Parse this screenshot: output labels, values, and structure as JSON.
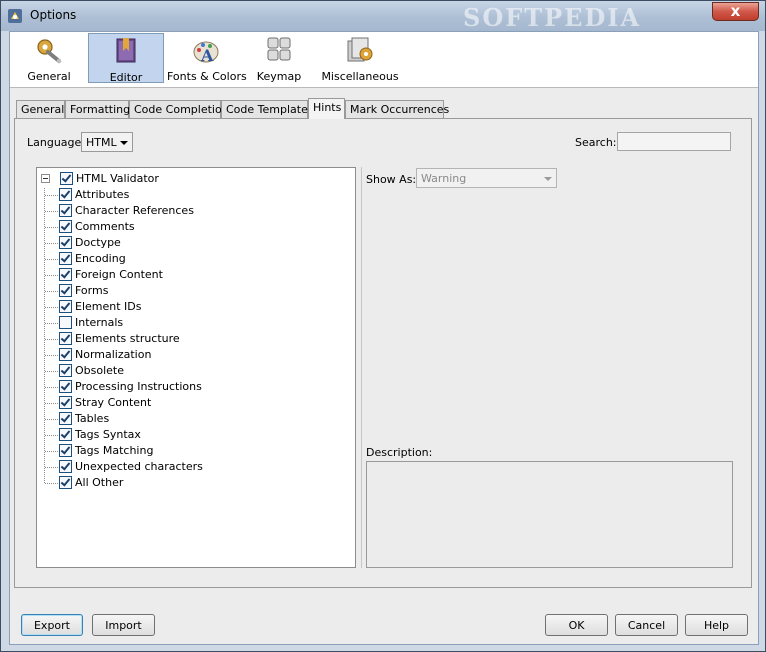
{
  "window": {
    "title": "Options",
    "watermark": "SOFTPEDIA",
    "close_symbol": "x"
  },
  "categories": [
    {
      "label": "General",
      "icon": "gear-wrench-icon"
    },
    {
      "label": "Editor",
      "icon": "editor-book-icon",
      "selected": true
    },
    {
      "label": "Fonts & Colors",
      "icon": "font-palette-icon"
    },
    {
      "label": "Keymap",
      "icon": "keyboard-icon"
    },
    {
      "label": "Miscellaneous",
      "icon": "misc-gear-icon"
    }
  ],
  "tabs": [
    {
      "label": "General"
    },
    {
      "label": "Formatting"
    },
    {
      "label": "Code Completion"
    },
    {
      "label": "Code Templates"
    },
    {
      "label": "Hints",
      "selected": true
    },
    {
      "label": "Mark Occurrences"
    }
  ],
  "hints": {
    "language_label": "Language:",
    "language_value": "HTML",
    "search_label": "Search:",
    "search_value": "",
    "tree": {
      "root": {
        "label": "HTML Validator",
        "checked": true
      },
      "items": [
        {
          "label": "Attributes",
          "checked": true
        },
        {
          "label": "Character References",
          "checked": true
        },
        {
          "label": "Comments",
          "checked": true
        },
        {
          "label": "Doctype",
          "checked": true
        },
        {
          "label": "Encoding",
          "checked": true
        },
        {
          "label": "Foreign Content",
          "checked": true
        },
        {
          "label": "Forms",
          "checked": true
        },
        {
          "label": "Element IDs",
          "checked": true
        },
        {
          "label": "Internals",
          "checked": false
        },
        {
          "label": "Elements structure",
          "checked": true
        },
        {
          "label": "Normalization",
          "checked": true
        },
        {
          "label": "Obsolete",
          "checked": true
        },
        {
          "label": "Processing Instructions",
          "checked": true
        },
        {
          "label": "Stray Content",
          "checked": true
        },
        {
          "label": "Tables",
          "checked": true
        },
        {
          "label": "Tags Syntax",
          "checked": true
        },
        {
          "label": "Tags Matching",
          "checked": true
        },
        {
          "label": "Unexpected characters",
          "checked": true
        },
        {
          "label": "All Other",
          "checked": true
        }
      ]
    },
    "show_as_label": "Show As:",
    "show_as_value": "Warning",
    "description_label": "Description:"
  },
  "buttons": {
    "export": "Export",
    "import": "Import",
    "ok": "OK",
    "cancel": "Cancel",
    "help": "Help"
  }
}
